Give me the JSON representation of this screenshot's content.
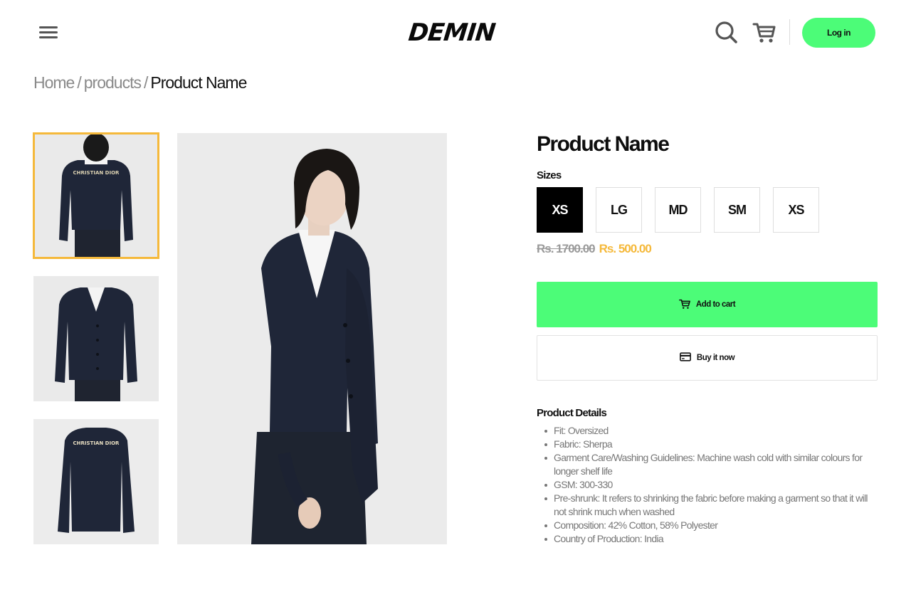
{
  "header": {
    "menu_icon": "hamburger-menu-icon",
    "logo_text": "DEMIN",
    "search_icon": "search-icon",
    "cart_icon": "cart-icon",
    "login_label": "Log in"
  },
  "breadcrumb": {
    "items": [
      "Home",
      "products"
    ],
    "separator": "/",
    "current": "Product Name"
  },
  "gallery": {
    "thumbnails": [
      {
        "name": "cardigan-back-worn",
        "active": true
      },
      {
        "name": "cardigan-front-worn",
        "active": false
      },
      {
        "name": "cardigan-back-flat",
        "active": false
      }
    ],
    "thumb_print_text": "CHRISTIAN DIOR",
    "main_image": "cardigan-side-model"
  },
  "product": {
    "title": "Product Name",
    "sizes_label": "Sizes",
    "sizes": [
      {
        "label": "XS",
        "selected": true
      },
      {
        "label": "LG",
        "selected": false
      },
      {
        "label": "MD",
        "selected": false
      },
      {
        "label": "SM",
        "selected": false
      },
      {
        "label": "XS",
        "selected": false
      }
    ],
    "old_price": "Rs. 1700.00",
    "new_price": "Rs. 500.00",
    "add_to_cart_label": "Add to cart",
    "add_to_cart_icon": "cart-icon",
    "buy_now_label": "Buy it now",
    "buy_now_icon": "credit-card-icon",
    "details_heading": "Product Details",
    "details": [
      "Fit: Oversized",
      "Fabric: Sherpa",
      "Garment Care/Washing Guidelines: Machine wash cold with similar colours for longer shelf life",
      "GSM: 300-330",
      "Pre-shrunk: It refers to shrinking the fabric before making a garment so that it will not shrink much when washed",
      "Composition: 42% Cotton, 58% Polyester",
      "Country of Production: India"
    ]
  },
  "colors": {
    "accent_green": "#4cfc78",
    "accent_gold": "#f5b93b",
    "selected_size_bg": "#000000",
    "muted_text": "#777777"
  }
}
